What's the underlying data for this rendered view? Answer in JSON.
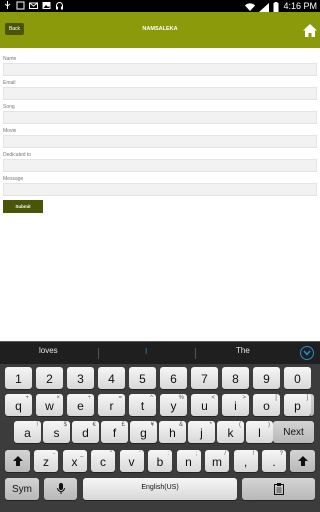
{
  "status_bar": {
    "time": "4:16 PM",
    "left_icons": [
      "usb-icon",
      "screenshot-icon",
      "mail-icon",
      "image-icon",
      "headphones-icon"
    ],
    "right_icons": [
      "wifi-icon",
      "signal-icon",
      "battery-icon"
    ]
  },
  "app_bar": {
    "back_label": "Back",
    "title": "NAMSALEKA",
    "home_icon": "home-icon",
    "color": "#8a9a0a"
  },
  "form": {
    "fields": [
      {
        "label": "Name",
        "value": ""
      },
      {
        "label": "Email",
        "value": ""
      },
      {
        "label": "Song",
        "value": ""
      },
      {
        "label": "Movie",
        "value": ""
      },
      {
        "label": "Dedicated to",
        "value": ""
      },
      {
        "label": "Message",
        "value": ""
      }
    ],
    "submit_label": "Submit"
  },
  "keyboard": {
    "suggestions": [
      "loves",
      "l",
      "The"
    ],
    "collapse_icon": "chevron-down-icon",
    "row_numbers": [
      "1",
      "2",
      "3",
      "4",
      "5",
      "6",
      "7",
      "8",
      "9",
      "0"
    ],
    "row1": [
      {
        "main": "q",
        "alt": "+"
      },
      {
        "main": "w",
        "alt": "×"
      },
      {
        "main": "e",
        "alt": "÷"
      },
      {
        "main": "r",
        "alt": "="
      },
      {
        "main": "t",
        "alt": "^"
      },
      {
        "main": "y",
        "alt": "%"
      },
      {
        "main": "u",
        "alt": "<"
      },
      {
        "main": "i",
        "alt": ">"
      },
      {
        "main": "o",
        "alt": "["
      },
      {
        "main": "p",
        "alt": "]"
      }
    ],
    "row2": [
      {
        "main": "a",
        "alt": "!"
      },
      {
        "main": "s",
        "alt": "$"
      },
      {
        "main": "d",
        "alt": "€"
      },
      {
        "main": "f",
        "alt": "£"
      },
      {
        "main": "g",
        "alt": "¥"
      },
      {
        "main": "h",
        "alt": "&"
      },
      {
        "main": "j",
        "alt": "*"
      },
      {
        "main": "k",
        "alt": "("
      },
      {
        "main": "l",
        "alt": ")"
      }
    ],
    "row3": [
      {
        "main": "z",
        "alt": "-"
      },
      {
        "main": "x",
        "alt": "_"
      },
      {
        "main": "c",
        "alt": "\""
      },
      {
        "main": "v",
        "alt": "'"
      },
      {
        "main": "b",
        "alt": ":"
      },
      {
        "main": "n",
        "alt": ";"
      },
      {
        "main": "m",
        "alt": "/"
      },
      {
        "main": ",",
        "alt": "!"
      },
      {
        "main": ".",
        "alt": "?"
      }
    ],
    "next_label": "Next",
    "sym_label": "Sym",
    "space_label": "English(US)"
  }
}
